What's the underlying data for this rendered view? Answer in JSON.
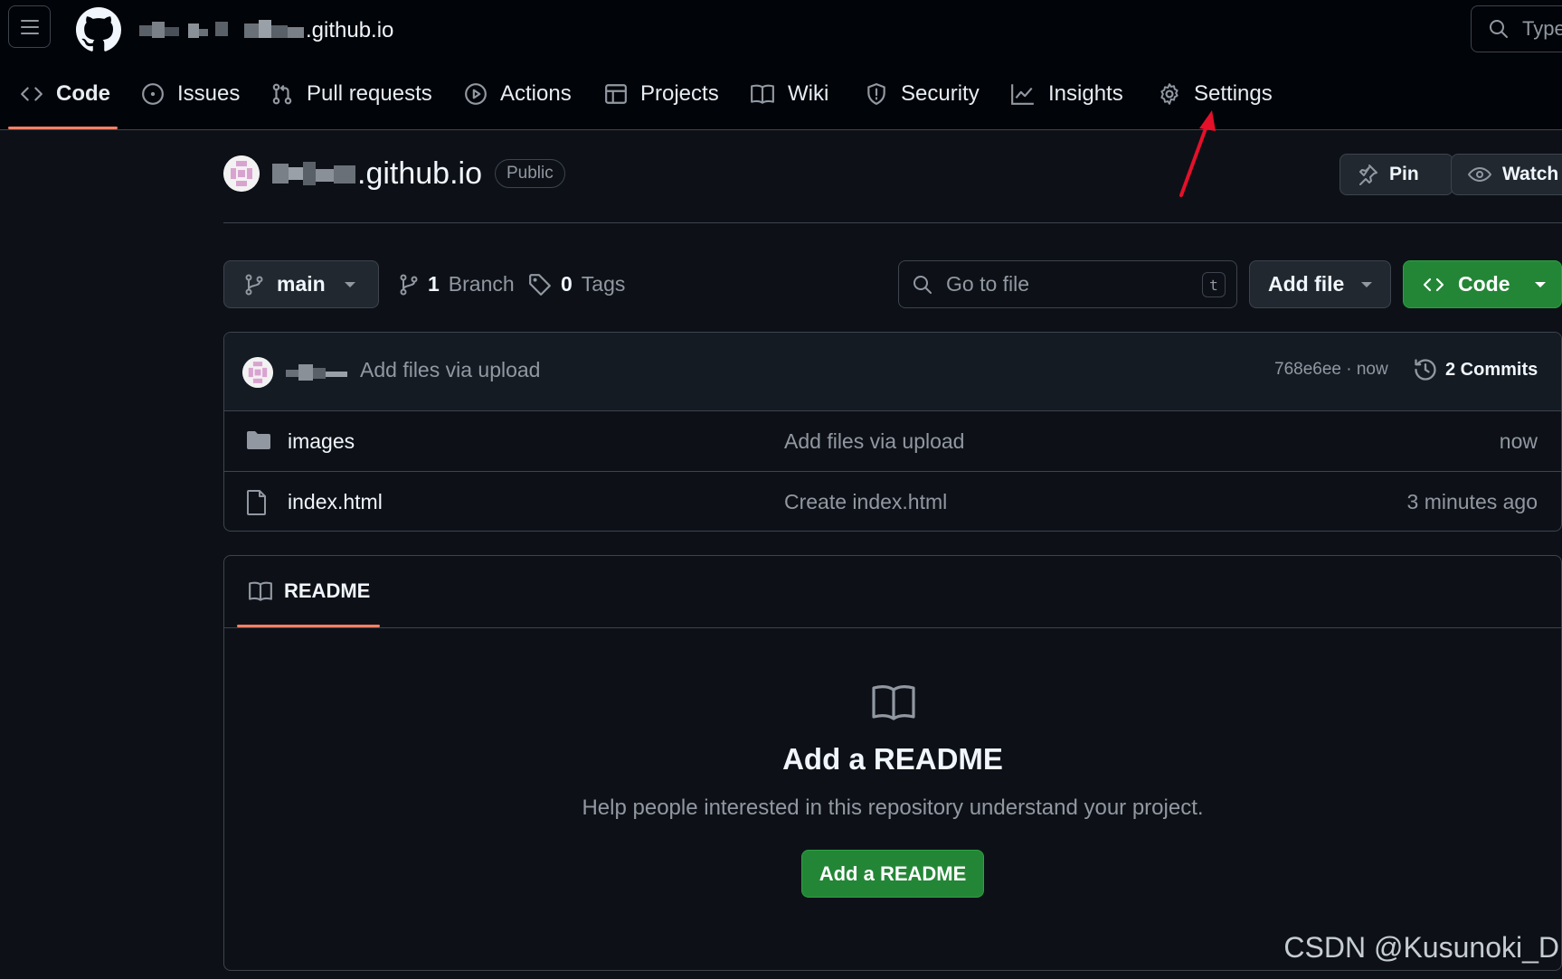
{
  "header": {
    "repo_suffix": ".github.io",
    "search_placeholder": "Type"
  },
  "tabs": [
    {
      "label": "Code",
      "selected": true
    },
    {
      "label": "Issues"
    },
    {
      "label": "Pull requests"
    },
    {
      "label": "Actions"
    },
    {
      "label": "Projects"
    },
    {
      "label": "Wiki"
    },
    {
      "label": "Security"
    },
    {
      "label": "Insights"
    },
    {
      "label": "Settings"
    }
  ],
  "repo": {
    "name_suffix": ".github.io",
    "visibility": "Public",
    "pin_label": "Pin",
    "watch_label": "Watch"
  },
  "toolbar": {
    "branch": "main",
    "branch_count": "1",
    "branch_word": "Branch",
    "tag_count": "0",
    "tag_word": "Tags",
    "goto_placeholder": "Go to file",
    "goto_shortcut": "t",
    "add_file_label": "Add file",
    "code_label": "Code"
  },
  "latest_commit": {
    "message": "Add files via upload",
    "sha_time": "768e6ee · now",
    "commits_label": "2 Commits"
  },
  "files": [
    {
      "type": "folder",
      "name": "images",
      "commit": "Add files via upload",
      "age": "now"
    },
    {
      "type": "file",
      "name": "index.html",
      "commit": "Create index.html",
      "age": "3 minutes ago"
    }
  ],
  "readme": {
    "tab_label": "README",
    "title": "Add a README",
    "subtitle": "Help people interested in this repository understand your project.",
    "button_label": "Add a README"
  },
  "watermark": "CSDN @Kusunoki_D",
  "colors": {
    "background": "#0d1117",
    "header_bg": "#010409",
    "border": "#3d444d",
    "accent_underline": "#f78166",
    "primary_button": "#238636",
    "annotation_arrow": "#e5102a"
  }
}
